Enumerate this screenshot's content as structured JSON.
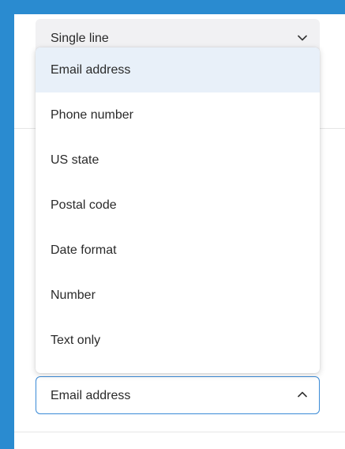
{
  "top_select": {
    "value": "Single line",
    "icon": "chevron-down-icon"
  },
  "dropdown": {
    "options": [
      {
        "label": "Email address",
        "highlighted": true
      },
      {
        "label": "Phone number",
        "highlighted": false
      },
      {
        "label": "US state",
        "highlighted": false
      },
      {
        "label": "Postal code",
        "highlighted": false
      },
      {
        "label": "Date format",
        "highlighted": false
      },
      {
        "label": "Number",
        "highlighted": false
      },
      {
        "label": "Text only",
        "highlighted": false
      }
    ]
  },
  "bottom_select": {
    "value": "Email address",
    "icon": "chevron-up-icon",
    "state": "open"
  },
  "colors": {
    "frame_border": "#2a8bd0",
    "highlight_bg": "#e8f0f9",
    "focus_border": "#3a8ad6",
    "text": "#2a2a2a"
  }
}
